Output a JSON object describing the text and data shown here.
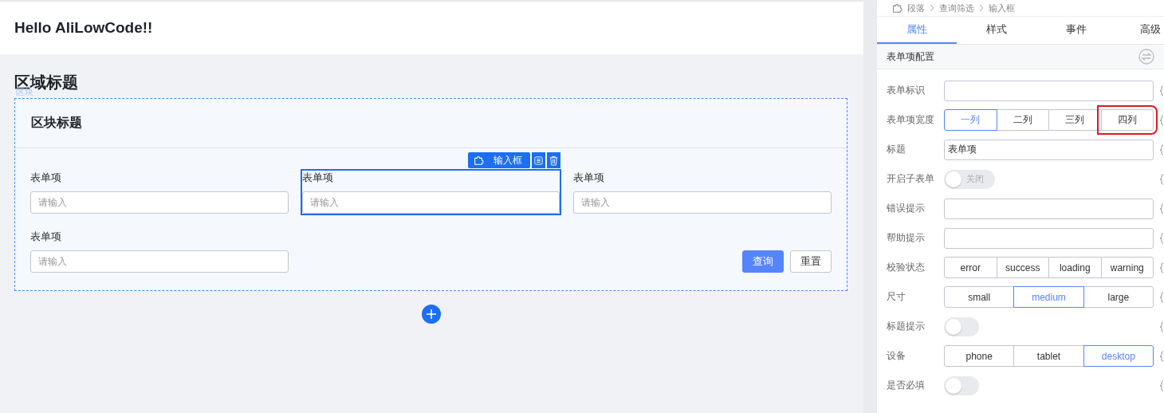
{
  "page_header": {
    "title": "Hello AliLowCode!!"
  },
  "section": {
    "title": "区域标题",
    "block_tag": "区块"
  },
  "card": {
    "title": "区块标题",
    "fields": [
      {
        "label": "表单项",
        "placeholder": "请输入",
        "selected": false
      },
      {
        "label": "表单项",
        "placeholder": "请输入",
        "selected": true
      },
      {
        "label": "表单项",
        "placeholder": "请输入",
        "selected": false
      },
      {
        "label": "表单项",
        "placeholder": "请输入",
        "selected": false
      }
    ],
    "selection_toolbar": {
      "label": "输入框"
    },
    "buttons": [
      {
        "label": "查询",
        "kind": "primary"
      },
      {
        "label": "重置",
        "kind": "normal"
      }
    ]
  },
  "panel": {
    "breadcrumb": [
      "段落",
      "查询筛选",
      "输入框"
    ],
    "tabs": [
      {
        "label": "属性",
        "selected": true
      },
      {
        "label": "样式",
        "selected": false
      },
      {
        "label": "事件",
        "selected": false
      },
      {
        "label": "高级",
        "selected": false
      }
    ],
    "group_title": "表单项配置",
    "rows": [
      {
        "label": "表单标识",
        "kind": "input"
      },
      {
        "label": "表单项宽度",
        "kind": "segmented",
        "options": [
          {
            "label": "一列",
            "selected": true,
            "highlighted": false
          },
          {
            "label": "二列",
            "selected": false,
            "highlighted": false
          },
          {
            "label": "三列",
            "selected": false,
            "highlighted": false
          },
          {
            "label": "四列",
            "selected": false,
            "highlighted": true
          }
        ]
      },
      {
        "label": "标题",
        "kind": "input",
        "value": "表单项"
      },
      {
        "label": "开启子表单",
        "kind": "switch",
        "on": false,
        "text": "关闭"
      },
      {
        "label": "错误提示",
        "kind": "input"
      },
      {
        "label": "帮助提示",
        "kind": "input"
      },
      {
        "label": "校验状态",
        "kind": "segmented",
        "options": [
          {
            "label": "error",
            "selected": false,
            "highlighted": false
          },
          {
            "label": "success",
            "selected": false,
            "highlighted": false
          },
          {
            "label": "loading",
            "selected": false,
            "highlighted": false
          },
          {
            "label": "warning",
            "selected": false,
            "highlighted": false
          }
        ]
      },
      {
        "label": "尺寸",
        "kind": "segmented",
        "options": [
          {
            "label": "small",
            "selected": false,
            "highlighted": false
          },
          {
            "label": "medium",
            "selected": true,
            "highlighted": false
          },
          {
            "label": "large",
            "selected": false,
            "highlighted": false
          }
        ]
      },
      {
        "label": "标题提示",
        "kind": "switch",
        "on": false
      },
      {
        "label": "设备",
        "kind": "segmented",
        "options": [
          {
            "label": "phone",
            "selected": false,
            "highlighted": false
          },
          {
            "label": "tablet",
            "selected": false,
            "highlighted": false
          },
          {
            "label": "desktop",
            "selected": true,
            "highlighted": false
          }
        ]
      },
      {
        "label": "是否必填",
        "kind": "switch",
        "on": false
      }
    ]
  }
}
